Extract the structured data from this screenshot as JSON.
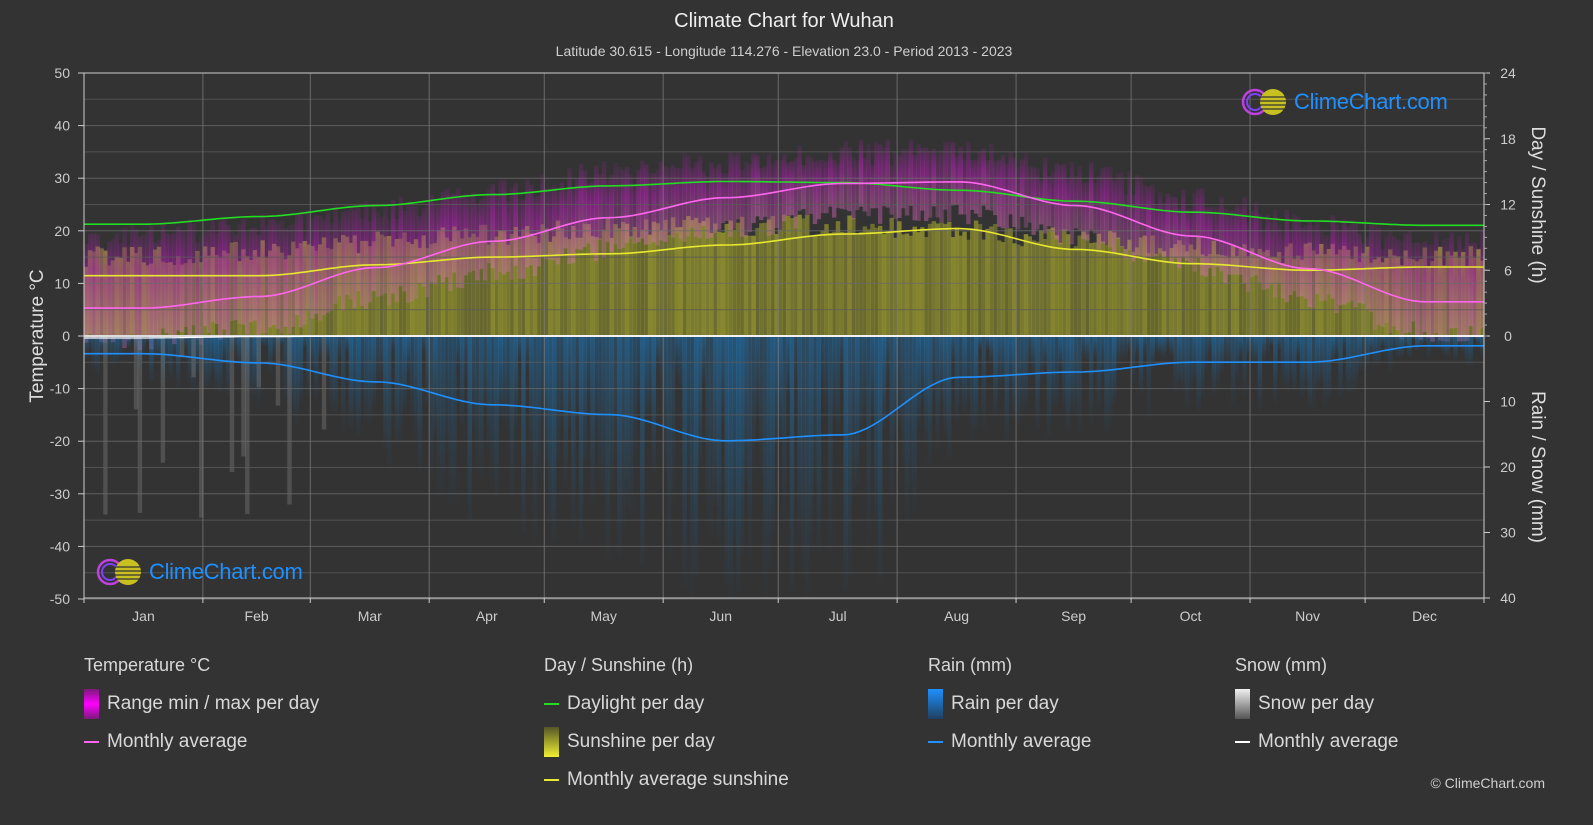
{
  "header": {
    "title": "Climate Chart for Wuhan",
    "subtitle": "Latitude 30.615 - Longitude 114.276 - Elevation 23.0 - Period 2013 - 2023"
  },
  "logo": {
    "text": "ClimeChart.com"
  },
  "copyright": "© ClimeChart.com",
  "colors": {
    "background": "#333333",
    "temp_avg": "#ff66ee",
    "temp_range": "#cc22cc",
    "daylight": "#22dd22",
    "sunshine_avg": "#e8e830",
    "sunshine_bar": "#8c8c30",
    "rain_avg": "#1e90ff",
    "rain_bar": "#1f5c8a",
    "snow_avg": "#ffffff",
    "grid": "#666666"
  },
  "legend": {
    "temperature": {
      "title": "Temperature °C",
      "items": [
        "Range min / max per day",
        "Monthly average"
      ]
    },
    "sunshine": {
      "title": "Day / Sunshine (h)",
      "items": [
        "Daylight per day",
        "Sunshine per day",
        "Monthly average sunshine"
      ]
    },
    "rain": {
      "title": "Rain (mm)",
      "items": [
        "Rain per day",
        "Monthly average"
      ]
    },
    "snow": {
      "title": "Snow (mm)",
      "items": [
        "Snow per day",
        "Monthly average"
      ]
    }
  },
  "chart_data": {
    "type": "line",
    "title": "Climate Chart for Wuhan",
    "categories": [
      "Jan",
      "Feb",
      "Mar",
      "Apr",
      "May",
      "Jun",
      "Jul",
      "Aug",
      "Sep",
      "Oct",
      "Nov",
      "Dec"
    ],
    "axes": {
      "left": {
        "label": "Temperature °C",
        "range": [
          -50,
          50
        ],
        "ticks": [
          50,
          40,
          30,
          20,
          10,
          0,
          -10,
          -20,
          -30,
          -40,
          -50
        ]
      },
      "right_top": {
        "label": "Day / Sunshine (h)",
        "range": [
          0,
          24
        ],
        "ticks": [
          24,
          18,
          12,
          6,
          0
        ]
      },
      "right_bottom": {
        "label": "Rain / Snow (mm)",
        "range": [
          0,
          40
        ],
        "ticks": [
          10,
          20,
          30,
          40
        ]
      }
    },
    "grid": true,
    "series": [
      {
        "name": "Temperature monthly average",
        "unit": "°C",
        "axis": "left",
        "values": [
          5.3,
          7.5,
          13.0,
          18.0,
          22.5,
          26.3,
          29.0,
          29.3,
          24.8,
          19.0,
          12.8,
          6.5
        ]
      },
      {
        "name": "Temperature daily max (approx. upper range)",
        "unit": "°C",
        "axis": "left",
        "values": [
          19,
          21,
          24,
          28,
          31,
          33,
          35,
          35,
          31,
          26,
          21,
          18
        ]
      },
      {
        "name": "Daylight per day",
        "unit": "h",
        "axis": "right_top",
        "values": [
          10.2,
          10.9,
          11.9,
          12.9,
          13.7,
          14.1,
          14.0,
          13.3,
          12.3,
          11.3,
          10.5,
          10.1
        ]
      },
      {
        "name": "Monthly average sunshine",
        "unit": "h",
        "axis": "right_top",
        "values": [
          5.5,
          5.5,
          6.5,
          7.2,
          7.5,
          8.3,
          9.3,
          9.8,
          7.9,
          6.6,
          6.0,
          6.3
        ]
      },
      {
        "name": "Rain monthly average",
        "unit": "mm",
        "axis": "right_bottom",
        "values": [
          2.7,
          4.1,
          7.0,
          10.5,
          12.0,
          16.0,
          15.1,
          6.3,
          5.5,
          4.0,
          4.0,
          1.5
        ]
      },
      {
        "name": "Snow monthly average",
        "unit": "mm",
        "axis": "right_bottom",
        "values": [
          0.3,
          0.1,
          0,
          0,
          0,
          0,
          0,
          0,
          0,
          0,
          0,
          0
        ]
      }
    ]
  }
}
